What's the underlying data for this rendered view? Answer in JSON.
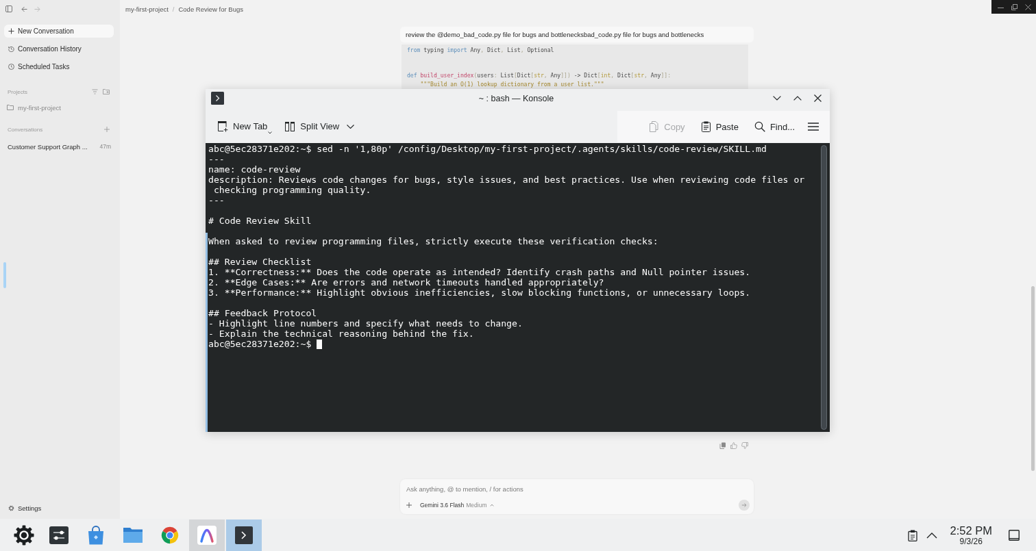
{
  "sidebar": {
    "nav_items": [
      {
        "label": "New Conversation",
        "kind": "new",
        "selected": true
      },
      {
        "label": "Conversation History",
        "kind": "history",
        "selected": false
      },
      {
        "label": "Scheduled Tasks",
        "kind": "scheduled",
        "selected": false
      }
    ],
    "projects": {
      "title": "Projects",
      "items": [
        {
          "label": "my-first-project"
        }
      ]
    },
    "conversations": {
      "title": "Conversations",
      "items": [
        {
          "label": "Customer Support Graph ...",
          "time": "47m"
        }
      ]
    },
    "settings": {
      "label": "Settings"
    }
  },
  "breadcrumb": {
    "items": [
      "my-first-project",
      "Code Review for Bugs"
    ],
    "separator": "/"
  },
  "conversation": {
    "user_message": "review the @demo_bad_code.py file for bugs and bottlenecksbad_code.py file for bugs and bottlenecks",
    "code_block": {
      "groups": [
        {
          "lines": [
            {
              "tokens": [
                {
                  "text": "from",
                  "kind": "keyword"
                },
                {
                  "text": " typing ",
                  "kind": "plain"
                },
                {
                  "text": "import",
                  "kind": "keyword"
                },
                {
                  "text": " Any",
                  "kind": "plain"
                },
                {
                  "text": ", ",
                  "kind": "punct"
                },
                {
                  "text": "Dict",
                  "kind": "plain"
                },
                {
                  "text": ", ",
                  "kind": "punct"
                },
                {
                  "text": "List",
                  "kind": "plain"
                },
                {
                  "text": ", ",
                  "kind": "punct"
                },
                {
                  "text": "Optional",
                  "kind": "plain"
                }
              ]
            }
          ]
        },
        {
          "lines": [
            {
              "tokens": [
                {
                  "text": "def ",
                  "kind": "keyword"
                },
                {
                  "text": "build_user_index",
                  "kind": "function"
                },
                {
                  "text": "(",
                  "kind": "punct"
                },
                {
                  "text": "users",
                  "kind": "plain"
                },
                {
                  "text": ": ",
                  "kind": "punct"
                },
                {
                  "text": "List",
                  "kind": "plain"
                },
                {
                  "text": "[",
                  "kind": "punct"
                },
                {
                  "text": "Dict",
                  "kind": "plain"
                },
                {
                  "text": "[",
                  "kind": "punct"
                },
                {
                  "text": "str",
                  "kind": "builtin"
                },
                {
                  "text": ", ",
                  "kind": "punct"
                },
                {
                  "text": "Any",
                  "kind": "plain"
                },
                {
                  "text": "]])",
                  "kind": "punct"
                },
                {
                  "text": " -> ",
                  "kind": "plain"
                },
                {
                  "text": "Dict",
                  "kind": "plain"
                },
                {
                  "text": "[",
                  "kind": "punct"
                },
                {
                  "text": "int",
                  "kind": "builtin"
                },
                {
                  "text": ", ",
                  "kind": "punct"
                },
                {
                  "text": "Dict",
                  "kind": "plain"
                },
                {
                  "text": "[",
                  "kind": "punct"
                },
                {
                  "text": "str",
                  "kind": "builtin"
                },
                {
                  "text": ", ",
                  "kind": "punct"
                },
                {
                  "text": "Any",
                  "kind": "plain"
                },
                {
                  "text": "]]:",
                  "kind": "punct"
                }
              ]
            },
            {
              "tokens": [
                {
                  "text": "    \"\"\"Build an O(1) lookup dictionary from a user list.\"\"\"",
                  "kind": "string"
                }
              ]
            }
          ]
        }
      ]
    }
  },
  "composer": {
    "placeholder": "Ask anything, @ to mention, / for actions",
    "model": "Gemini 3.6 Flash",
    "mode": "Medium"
  },
  "konsole": {
    "title": "~ : bash — Konsole",
    "toolbar": {
      "left": [
        {
          "label": "New Tab",
          "kind": "new-tab"
        },
        {
          "label": "Split View",
          "kind": "split-view"
        }
      ],
      "right": [
        {
          "label": "Copy",
          "kind": "copy",
          "disabled": true
        },
        {
          "label": "Paste",
          "kind": "paste",
          "disabled": false
        },
        {
          "label": "Find...",
          "kind": "find",
          "disabled": false
        }
      ]
    },
    "terminal": {
      "command_line": "abc@5ec28371e202:~$ sed -n '1,80p' /config/Desktop/my-first-project/.agents/skills/code-review/SKILL.md",
      "output_blocks": [
        [
          "---",
          "name: code-review",
          "description: Reviews code changes for bugs, style issues, and best practices. Use when reviewing code files or",
          " checking programming quality.",
          "---"
        ],
        [
          "# Code Review Skill"
        ],
        [
          "When asked to review programming files, strictly execute these verification checks:"
        ],
        [
          "## Review Checklist",
          "1. **Correctness:** Does the code operate as intended? Identify crash paths and Null pointer issues.",
          "2. **Edge Cases:** Are errors and network timeouts handled appropriately?",
          "3. **Performance:** Highlight obvious inefficiencies, slow blocking functions, or unnecessary loops."
        ],
        [
          "## Feedback Protocol",
          "- Highlight line numbers and specify what needs to change.",
          "- Explain the technical reasoning behind the fix."
        ]
      ],
      "prompt": "abc@5ec28371e202:~$"
    }
  },
  "taskbar": {
    "apps": [
      {
        "kind": "launcher",
        "open": false,
        "active": false
      },
      {
        "kind": "settings",
        "open": false,
        "active": false
      },
      {
        "kind": "store",
        "open": false,
        "active": false
      },
      {
        "kind": "files",
        "open": false,
        "active": false
      },
      {
        "kind": "browser",
        "open": false,
        "active": false
      },
      {
        "kind": "app",
        "open": true,
        "active": false
      },
      {
        "kind": "terminal",
        "open": true,
        "active": true
      }
    ],
    "clock": {
      "time": "2:52 PM",
      "date": "9/3/26"
    }
  }
}
